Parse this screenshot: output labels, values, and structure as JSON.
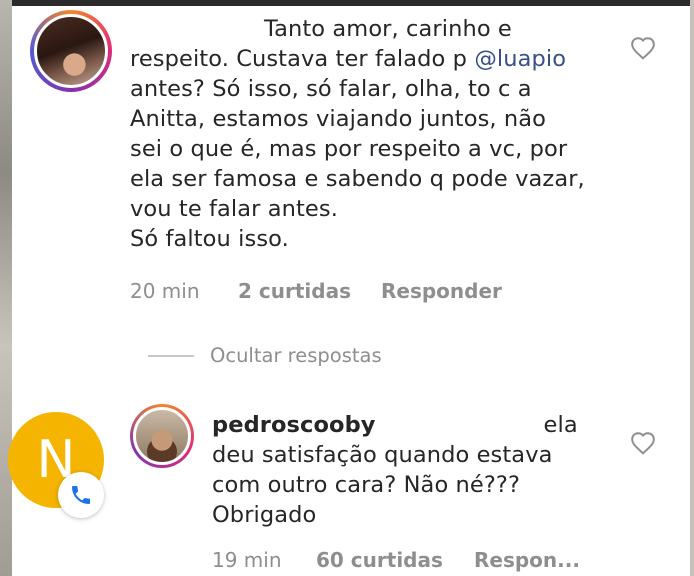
{
  "comment_1": {
    "lines": [
      "Tanto amor, carinho e",
      "respeito. Custava ter falado p ",
      "antes? Só isso, só falar, olha, to c a",
      "Anitta, estamos viajando juntos, não",
      "sei o que é, mas por respeito a vc, por",
      "ela ser famosa e sabendo q pode vazar,",
      "vou te falar antes.",
      "Só faltou isso."
    ],
    "mention": "@luapio",
    "time": "20 min",
    "likes": "2 curtidas",
    "reply": "Responder"
  },
  "hide_replies": "Ocultar respostas",
  "reply_1": {
    "username": "pedroscooby",
    "line1_tail": "ela",
    "lines": [
      "deu satisfação quando estava",
      "com outro cara? Não né???",
      "Obrigado"
    ],
    "time": "19 min",
    "likes": "60 curtidas",
    "reply": "Respon..."
  },
  "overlay_avatar": {
    "letter": "N",
    "color": "#f4b400"
  },
  "icons": {
    "like": "heart-outline-icon",
    "call": "phone-icon"
  }
}
